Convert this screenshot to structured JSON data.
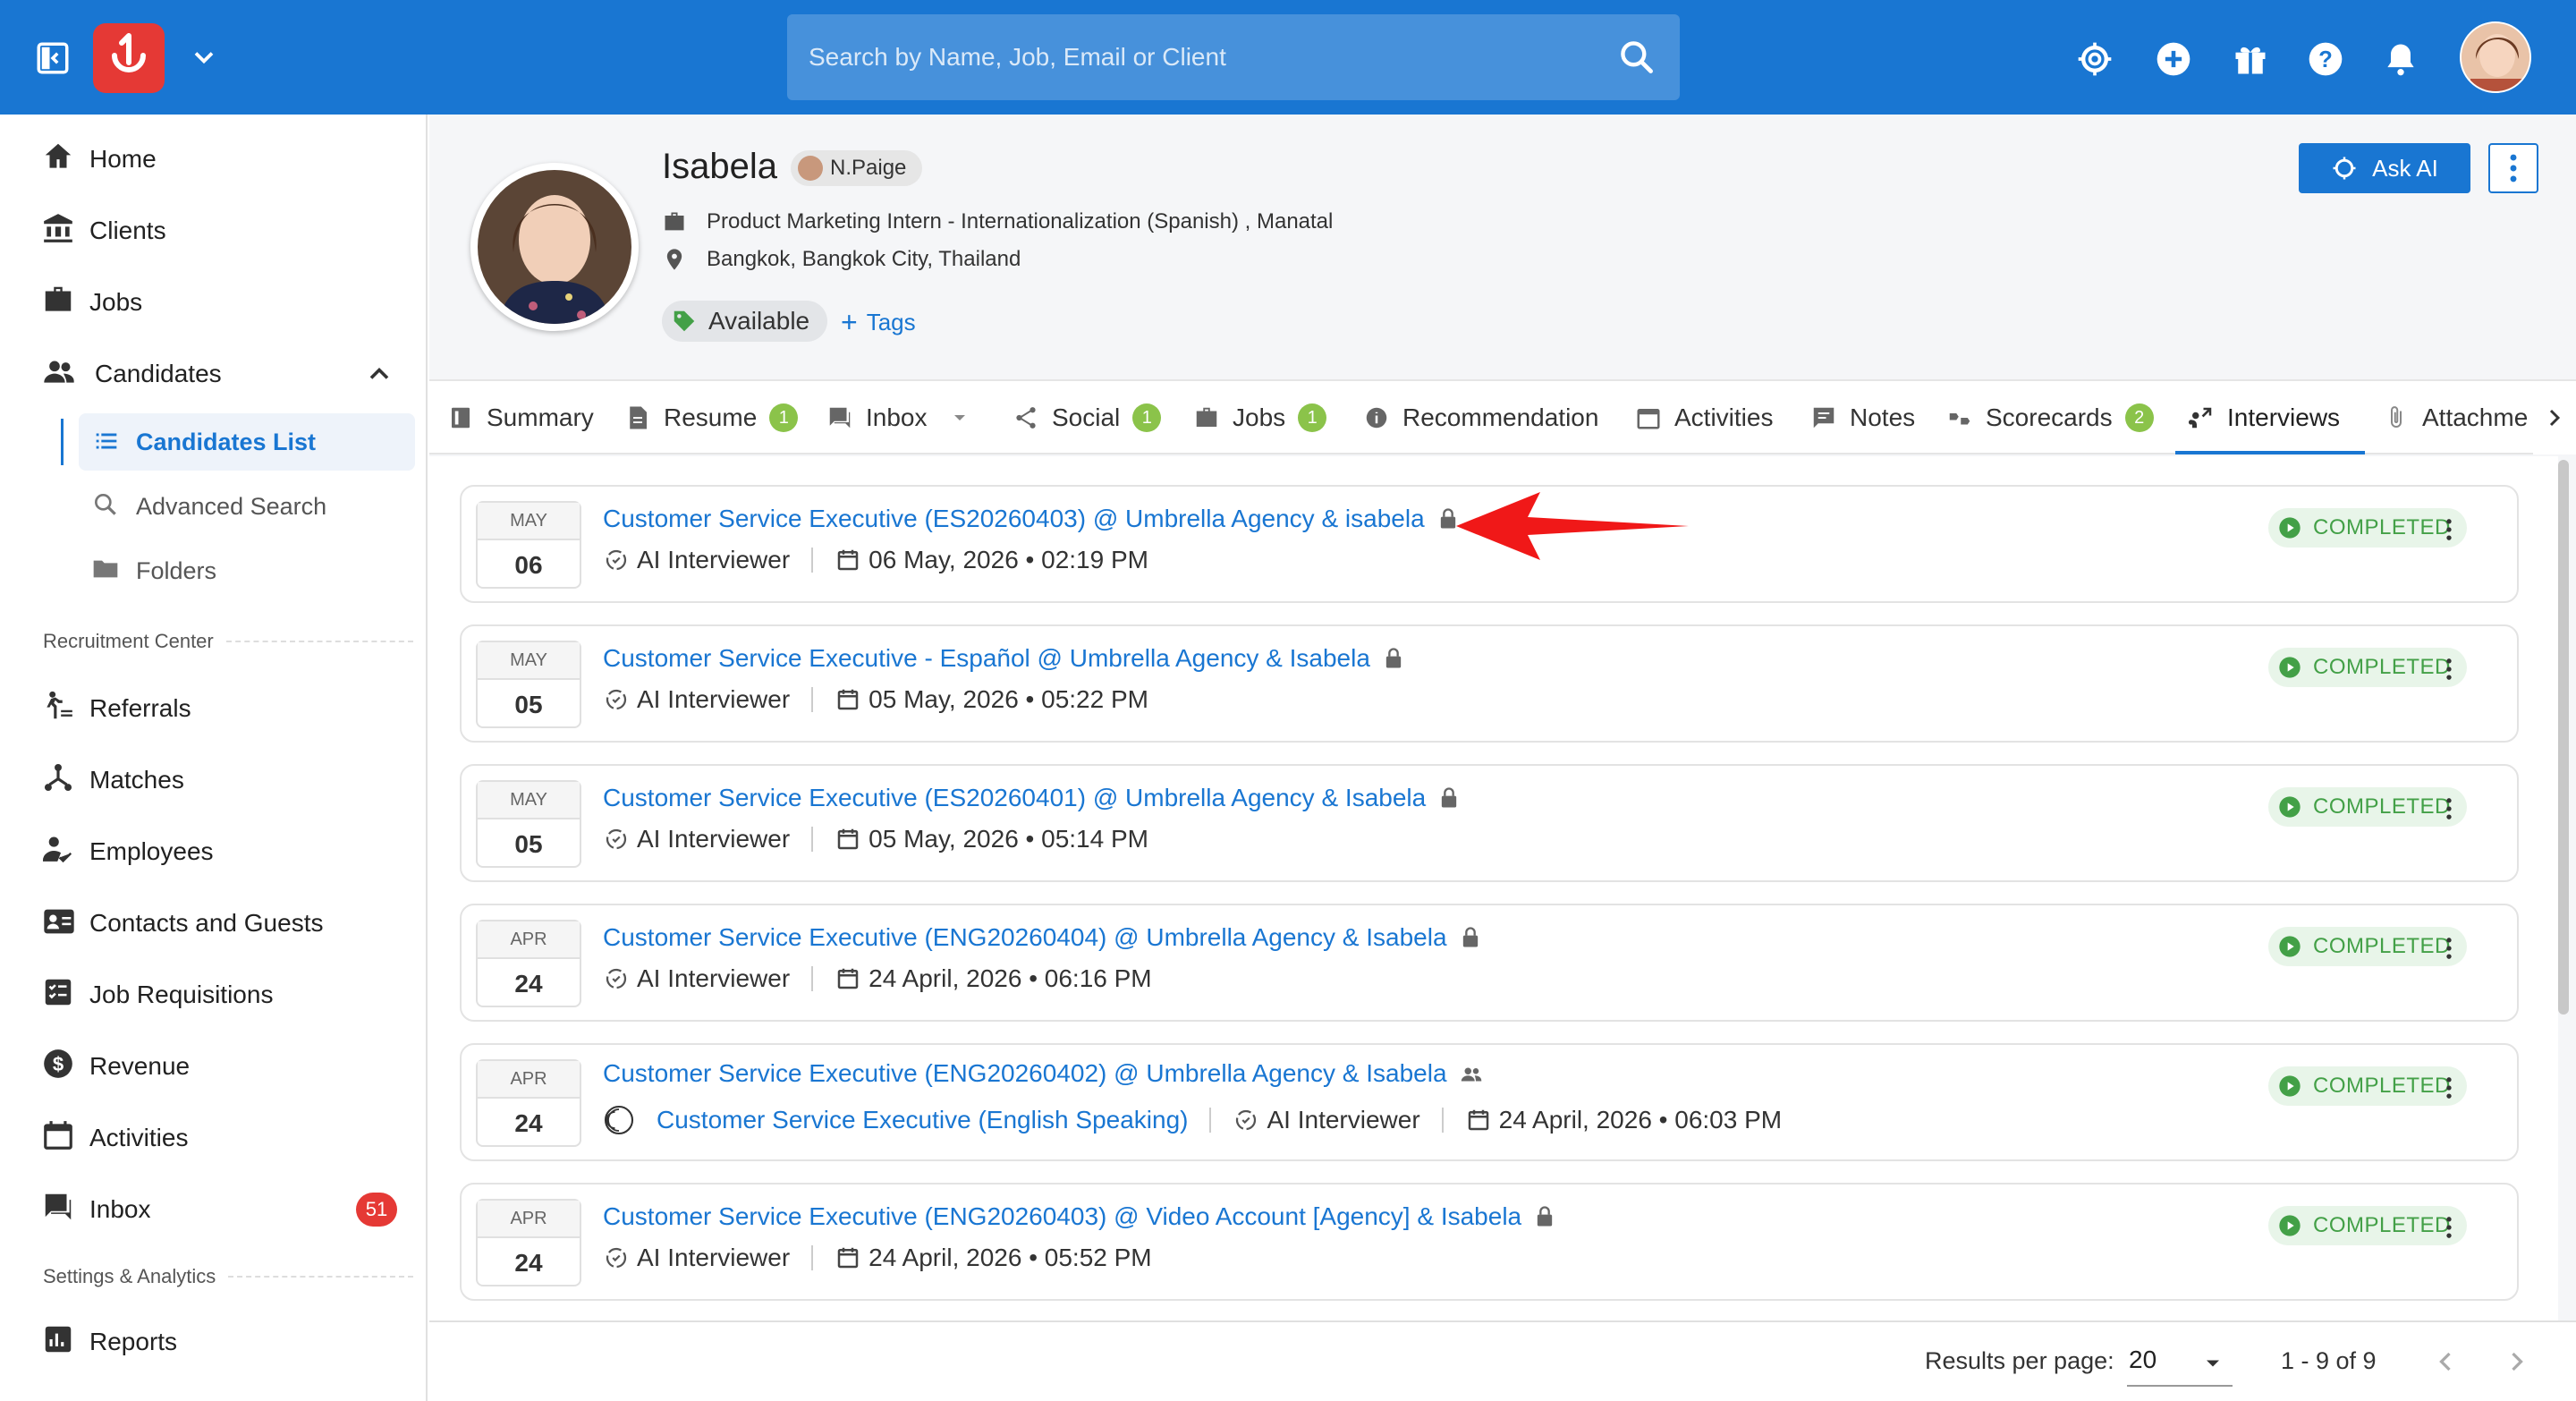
{
  "topbar": {
    "search_placeholder": "Search by Name, Job, Email or Client",
    "icons": [
      "sidebar-toggle-icon",
      "app-logo",
      "chevron-down-icon",
      "search-icon",
      "ai-icon",
      "add-icon",
      "gift-icon",
      "help-icon",
      "bell-icon",
      "avatar"
    ]
  },
  "sidebar": {
    "items": [
      {
        "label": "Home",
        "icon": "home-icon"
      },
      {
        "label": "Clients",
        "icon": "bank-icon"
      },
      {
        "label": "Jobs",
        "icon": "briefcase-icon"
      },
      {
        "label": "Candidates",
        "icon": "people-icon"
      }
    ],
    "candidates_sub": [
      {
        "label": "Candidates List",
        "icon": "list-icon"
      },
      {
        "label": "Advanced Search",
        "icon": "search-icon"
      },
      {
        "label": "Folders",
        "icon": "folder-icon"
      }
    ],
    "recruitment_center": "Recruitment Center",
    "recruitment_items": [
      {
        "label": "Referrals",
        "icon": "referral-icon"
      },
      {
        "label": "Matches",
        "icon": "matches-icon"
      },
      {
        "label": "Employees",
        "icon": "employee-icon"
      },
      {
        "label": "Contacts and Guests",
        "icon": "contacts-icon"
      },
      {
        "label": "Job Requisitions",
        "icon": "requisition-icon"
      },
      {
        "label": "Revenue",
        "icon": "dollar-icon"
      },
      {
        "label": "Activities",
        "icon": "calendar-icon"
      },
      {
        "label": "Inbox",
        "icon": "inbox-icon",
        "badge": "51"
      }
    ],
    "settings_analytics": "Settings & Analytics",
    "settings_items": [
      {
        "label": "Reports",
        "icon": "reports-icon"
      }
    ]
  },
  "profile": {
    "name": "Isabela",
    "owner": "N.Paige",
    "job": "Product Marketing Intern - Internationalization (Spanish) , Manatal",
    "location": "Bangkok, Bangkok City, Thailand",
    "status_tag": "Available",
    "tags_button": "Tags",
    "ask_ai": "Ask AI"
  },
  "tabs": [
    {
      "label": "Summary",
      "icon": "summary-icon"
    },
    {
      "label": "Resume",
      "icon": "document-icon",
      "count": "1"
    },
    {
      "label": "Inbox",
      "icon": "inbox-icon"
    },
    {
      "label": "Social",
      "icon": "share-icon",
      "count": "1"
    },
    {
      "label": "Jobs",
      "icon": "briefcase-icon",
      "count": "1"
    },
    {
      "label": "Recommendation",
      "icon": "info-icon"
    },
    {
      "label": "Activities",
      "icon": "calendar-icon"
    },
    {
      "label": "Notes",
      "icon": "notes-icon"
    },
    {
      "label": "Scorecards",
      "icon": "scorecard-icon",
      "count": "2"
    },
    {
      "label": "Interviews",
      "icon": "interviews-icon",
      "active": true
    },
    {
      "label": "Attachme",
      "icon": "attachment-icon"
    }
  ],
  "interviews": [
    {
      "month": "MAY",
      "day": "06",
      "title": "Customer Service Executive (ES20260403) @ Umbrella Agency & isabela",
      "icon": "lock-icon",
      "interviewer": "AI Interviewer",
      "datetime": "06 May, 2026 • 02:19 PM",
      "status": "COMPLETED"
    },
    {
      "month": "MAY",
      "day": "05",
      "title": "Customer Service Executive - Español @ Umbrella Agency & Isabela",
      "icon": "lock-icon",
      "interviewer": "AI Interviewer",
      "datetime": "05 May, 2026 • 05:22 PM",
      "status": "COMPLETED"
    },
    {
      "month": "MAY",
      "day": "05",
      "title": "Customer Service Executive (ES20260401) @ Umbrella Agency & Isabela",
      "icon": "lock-icon",
      "interviewer": "AI Interviewer",
      "datetime": "05 May, 2026 • 05:14 PM",
      "status": "COMPLETED"
    },
    {
      "month": "APR",
      "day": "24",
      "title": "Customer Service Executive (ENG20260404) @ Umbrella Agency & Isabela",
      "icon": "lock-icon",
      "interviewer": "AI Interviewer",
      "datetime": "24 April, 2026 • 06:16 PM",
      "status": "COMPLETED"
    },
    {
      "month": "APR",
      "day": "24",
      "title": "Customer Service Executive (ENG20260402) @ Umbrella Agency & Isabela",
      "icon": "group-icon",
      "job_link": "Customer Service Executive (English Speaking)",
      "interviewer": "AI Interviewer",
      "datetime": "24 April, 2026 • 06:03 PM",
      "status": "COMPLETED"
    },
    {
      "month": "APR",
      "day": "24",
      "title": "Customer Service Executive (ENG20260403) @ Video Account [Agency] & Isabela",
      "icon": "lock-icon",
      "interviewer": "AI Interviewer",
      "datetime": "24 April, 2026 • 05:52 PM",
      "status": "COMPLETED"
    }
  ],
  "pagination": {
    "label": "Results per page:",
    "per_page": "20",
    "range": "1 - 9 of 9"
  },
  "colors": {
    "primary": "#1976d2",
    "completed": "#43a047",
    "arrow": "#f01818"
  }
}
